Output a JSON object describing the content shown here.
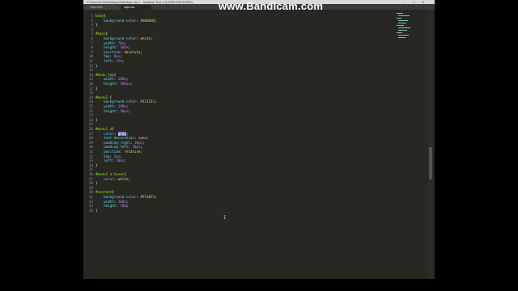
{
  "watermark": "www.Bandicam.com",
  "window": {
    "title": "C:\\Users\\123\\Desktop\\Sait\\style.css • - Sublime Text 2 (UNREGISTERED)",
    "controls": [
      "–",
      "□",
      "✕"
    ]
  },
  "tabs": [
    {
      "label": "index.html"
    },
    {
      "label": "style.css"
    }
  ],
  "lines": [
    {
      "n": "1",
      "segs": [
        {
          "c": "sel",
          "t": "body"
        },
        {
          "c": "pl",
          "t": "{"
        }
      ]
    },
    {
      "n": "2",
      "segs": [
        {
          "c": "prop",
          "t": "    background-color"
        },
        {
          "c": "pl",
          "t": ": "
        },
        {
          "c": "val",
          "t": "#d6d6d6"
        },
        {
          "c": "pl",
          "t": ";"
        }
      ]
    },
    {
      "n": "3",
      "segs": [
        {
          "c": "pl",
          "t": "}"
        }
      ]
    },
    {
      "n": "4",
      "segs": []
    },
    {
      "n": "5",
      "segs": [
        {
          "c": "sel",
          "t": "#main"
        },
        {
          "c": "pl",
          "t": "{"
        }
      ]
    },
    {
      "n": "6",
      "segs": [
        {
          "c": "prop",
          "t": "    background-color"
        },
        {
          "c": "pl",
          "t": ": "
        },
        {
          "c": "val",
          "t": "white"
        },
        {
          "c": "pl",
          "t": ";"
        }
      ]
    },
    {
      "n": "7",
      "segs": [
        {
          "c": "prop",
          "t": "    width"
        },
        {
          "c": "pl",
          "t": ": "
        },
        {
          "c": "num",
          "t": "70%"
        },
        {
          "c": "pl",
          "t": ";"
        }
      ]
    },
    {
      "n": "8",
      "segs": [
        {
          "c": "prop",
          "t": "    height"
        },
        {
          "c": "pl",
          "t": ": "
        },
        {
          "c": "num",
          "t": "100%"
        },
        {
          "c": "pl",
          "t": ";"
        }
      ]
    },
    {
      "n": "9",
      "segs": [
        {
          "c": "prop",
          "t": "    position"
        },
        {
          "c": "pl",
          "t": ": "
        },
        {
          "c": "val",
          "t": "absolute"
        },
        {
          "c": "pl",
          "t": ";"
        }
      ]
    },
    {
      "n": "10",
      "segs": [
        {
          "c": "prop",
          "t": "    top"
        },
        {
          "c": "pl",
          "t": ": "
        },
        {
          "c": "num",
          "t": "0px"
        },
        {
          "c": "pl",
          "t": ";"
        }
      ]
    },
    {
      "n": "11",
      "segs": [
        {
          "c": "prop",
          "t": "    left"
        },
        {
          "c": "pl",
          "t": ": "
        },
        {
          "c": "num",
          "t": "15%"
        },
        {
          "c": "pl",
          "t": ";"
        }
      ]
    },
    {
      "n": "12",
      "segs": [
        {
          "c": "pl",
          "t": "}"
        }
      ]
    },
    {
      "n": "13",
      "segs": []
    },
    {
      "n": "14",
      "segs": [
        {
          "c": "sel",
          "t": "#menu_top"
        },
        {
          "c": "pl",
          "t": "{"
        }
      ]
    },
    {
      "n": "15",
      "segs": [
        {
          "c": "prop",
          "t": "    width"
        },
        {
          "c": "pl",
          "t": ": "
        },
        {
          "c": "num",
          "t": "100%"
        },
        {
          "c": "pl",
          "t": ";"
        }
      ]
    },
    {
      "n": "16",
      "segs": [
        {
          "c": "prop",
          "t": "    height"
        },
        {
          "c": "pl",
          "t": ": "
        },
        {
          "c": "num",
          "t": "300px"
        },
        {
          "c": "pl",
          "t": ";"
        }
      ]
    },
    {
      "n": "17",
      "segs": [
        {
          "c": "pl",
          "t": "}"
        }
      ]
    },
    {
      "n": "18",
      "segs": []
    },
    {
      "n": "19",
      "segs": [
        {
          "c": "sel",
          "t": "#menu1"
        },
        {
          "c": "pl",
          "t": " {"
        }
      ]
    },
    {
      "n": "20",
      "segs": [
        {
          "c": "prop",
          "t": "    background-color"
        },
        {
          "c": "pl",
          "t": ": "
        },
        {
          "c": "val",
          "t": "#111111"
        },
        {
          "c": "pl",
          "t": ";"
        }
      ]
    },
    {
      "n": "21",
      "segs": [
        {
          "c": "prop",
          "t": "    width"
        },
        {
          "c": "pl",
          "t": ": "
        },
        {
          "c": "num",
          "t": "100%"
        },
        {
          "c": "pl",
          "t": ";"
        }
      ]
    },
    {
      "n": "22",
      "segs": [
        {
          "c": "prop",
          "t": "    height"
        },
        {
          "c": "pl",
          "t": ": "
        },
        {
          "c": "num",
          "t": "30px"
        },
        {
          "c": "pl",
          "t": ";"
        }
      ]
    },
    {
      "n": "23",
      "segs": []
    },
    {
      "n": "24",
      "segs": [
        {
          "c": "pl",
          "t": "}"
        }
      ]
    },
    {
      "n": "25",
      "segs": []
    },
    {
      "n": "26",
      "segs": [
        {
          "c": "sel",
          "t": "#menu1 a"
        },
        {
          "c": "pl",
          "t": "{"
        }
      ]
    },
    {
      "n": "27",
      "segs": [
        {
          "c": "prop",
          "t": "    color"
        },
        {
          "c": "pl",
          "t": ": "
        },
        {
          "c": "hl",
          "t": "gray"
        },
        {
          "c": "pl",
          "t": ";"
        }
      ]
    },
    {
      "n": "28",
      "segs": [
        {
          "c": "prop",
          "t": "    text-decoration"
        },
        {
          "c": "pl",
          "t": ": "
        },
        {
          "c": "val",
          "t": "none"
        },
        {
          "c": "pl",
          "t": ";"
        }
      ]
    },
    {
      "n": "29",
      "segs": [
        {
          "c": "prop",
          "t": "    padding-right"
        },
        {
          "c": "pl",
          "t": ": "
        },
        {
          "c": "num",
          "t": "10px"
        },
        {
          "c": "pl",
          "t": ";"
        }
      ]
    },
    {
      "n": "30",
      "segs": [
        {
          "c": "prop",
          "t": "    padding-left"
        },
        {
          "c": "pl",
          "t": ": "
        },
        {
          "c": "num",
          "t": "10px"
        },
        {
          "c": "pl",
          "t": ";"
        }
      ]
    },
    {
      "n": "31",
      "segs": [
        {
          "c": "prop",
          "t": "    position"
        },
        {
          "c": "pl",
          "t": ": "
        },
        {
          "c": "val",
          "t": "relative"
        },
        {
          "c": "pl",
          "t": ";"
        }
      ]
    },
    {
      "n": "32",
      "segs": [
        {
          "c": "prop",
          "t": "    top"
        },
        {
          "c": "pl",
          "t": ": "
        },
        {
          "c": "num",
          "t": "5px"
        },
        {
          "c": "pl",
          "t": ";"
        }
      ]
    },
    {
      "n": "33",
      "segs": [
        {
          "c": "prop",
          "t": "    left"
        },
        {
          "c": "pl",
          "t": ": "
        },
        {
          "c": "num",
          "t": "10px"
        },
        {
          "c": "pl",
          "t": ";"
        }
      ]
    },
    {
      "n": "34",
      "segs": [
        {
          "c": "pl",
          "t": "}"
        }
      ]
    },
    {
      "n": "35",
      "segs": []
    },
    {
      "n": "36",
      "segs": [
        {
          "c": "sel",
          "t": "#menu1 a:hover"
        },
        {
          "c": "pl",
          "t": "{"
        }
      ]
    },
    {
      "n": "37",
      "segs": [
        {
          "c": "prop",
          "t": "    color"
        },
        {
          "c": "pl",
          "t": ": "
        },
        {
          "c": "val",
          "t": "white"
        },
        {
          "c": "pl",
          "t": ";"
        }
      ]
    },
    {
      "n": "38",
      "segs": [
        {
          "c": "pl",
          "t": "}"
        }
      ]
    },
    {
      "n": "39",
      "segs": []
    },
    {
      "n": "40",
      "segs": [
        {
          "c": "sel",
          "t": "#content"
        },
        {
          "c": "pl",
          "t": "{"
        }
      ]
    },
    {
      "n": "41",
      "segs": [
        {
          "c": "prop",
          "t": "    background-color"
        },
        {
          "c": "pl",
          "t": ": "
        },
        {
          "c": "val",
          "t": "#5fa0f1"
        },
        {
          "c": "pl",
          "t": ";"
        }
      ]
    },
    {
      "n": "42",
      "segs": [
        {
          "c": "prop",
          "t": "    width"
        },
        {
          "c": "pl",
          "t": ": "
        },
        {
          "c": "num",
          "t": "100%"
        },
        {
          "c": "pl",
          "t": ";"
        }
      ]
    },
    {
      "n": "43",
      "segs": [
        {
          "c": "prop",
          "t": "    height"
        },
        {
          "c": "pl",
          "t": ": "
        },
        {
          "c": "num",
          "t": "700p"
        }
      ]
    },
    {
      "n": "44",
      "segs": [
        {
          "c": "pl",
          "t": "}"
        }
      ]
    }
  ]
}
